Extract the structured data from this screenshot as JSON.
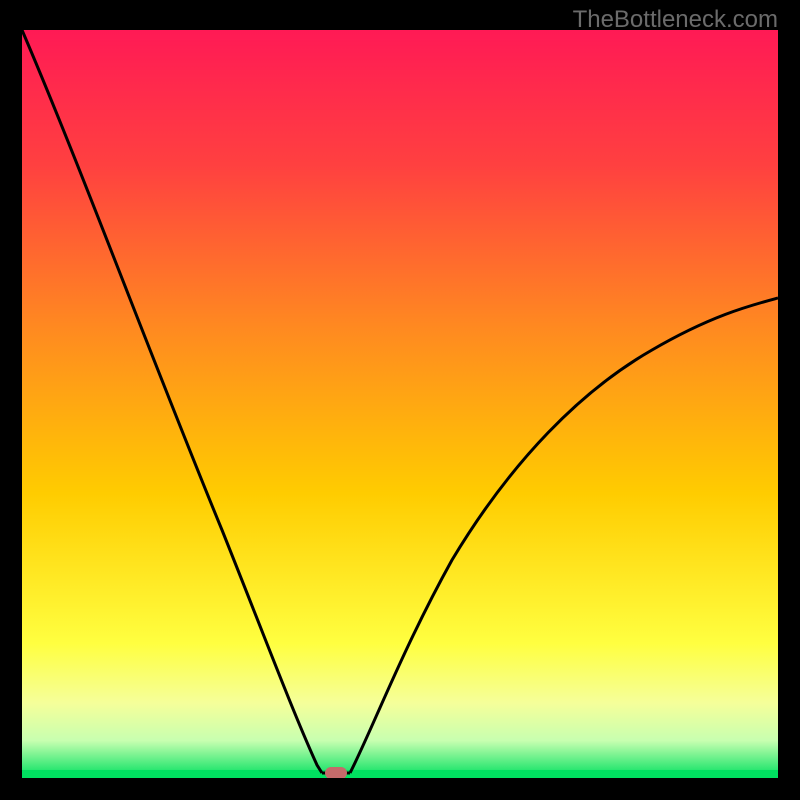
{
  "watermark": "TheBottleneck.com",
  "chart_data": {
    "type": "line",
    "title": "",
    "xlabel": "",
    "ylabel": "",
    "xlim": [
      0,
      100
    ],
    "ylim": [
      0,
      100
    ],
    "background_gradient_colors": [
      "#ff1a55",
      "#ff6a2a",
      "#ffcc00",
      "#ffff55",
      "#c8ff8c",
      "#00e060"
    ],
    "curve_comment": "Black V-shaped curve; two branches descending to a minimum near x≈40, y≈0. Left branch falls from top-left, right branch rises toward mid-right edge.",
    "series": [
      {
        "name": "left-branch",
        "x": [
          0,
          5,
          10,
          15,
          20,
          25,
          30,
          35,
          38,
          40
        ],
        "y": [
          100,
          88,
          75,
          62,
          49,
          36,
          23,
          11,
          3,
          0
        ]
      },
      {
        "name": "right-branch",
        "x": [
          40,
          44,
          50,
          55,
          60,
          65,
          70,
          75,
          80,
          85,
          90,
          95,
          100
        ],
        "y": [
          0,
          3,
          12,
          20,
          27,
          34,
          40,
          45,
          50,
          54,
          58,
          61,
          64
        ]
      }
    ],
    "marker": {
      "x": 40,
      "y": 0,
      "color": "#c46a6a",
      "shape": "rounded-rect"
    },
    "bottom_thin_band_color": "#00e060"
  }
}
